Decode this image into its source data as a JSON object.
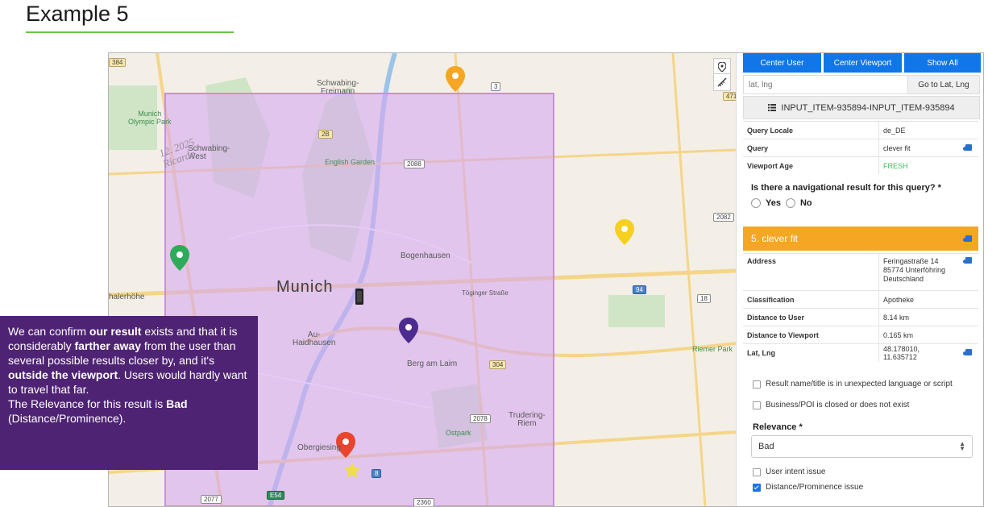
{
  "page": {
    "title": "Example 5",
    "accent_color": "#6cc24a"
  },
  "map": {
    "labels": {
      "schwabing_freimann": "Schwabing-\nFreimann",
      "munich_olympic_park": "Munich\nOlympic Park",
      "schwabing_west": "Schwabing-\nWest",
      "english_garden": "English Garden",
      "bogenhausen": "Bogenhausen",
      "munich": "Munich",
      "toginger_strasse": "Töginger Straße",
      "halerhohe": "halerhöhe",
      "au_haidhausen": "Au-\nHaidhausen",
      "berg_am_laim": "Berg am Laim",
      "riemer_park": "Riemer Park",
      "trudering_riem": "Trudering-\nRiem",
      "ostpark": "Ostpark",
      "obergiesing": "Obergiesing",
      "signature": "12. 2025\nRicardo"
    },
    "road_badges": [
      "384",
      "3",
      "471",
      "2B",
      "2088",
      "2082",
      "94",
      "18",
      "304",
      "2078",
      "8",
      "2077",
      "E54",
      "2360"
    ],
    "region_color": "#d6a9f0",
    "pin_colors": {
      "orange": "#f5a623",
      "yellow": "#f5d020",
      "green": "#2eab5a",
      "purple": "#4d2c91",
      "red": "#e8442e"
    }
  },
  "panel": {
    "buttons": {
      "center_user": "Center User",
      "center_viewport": "Center Viewport",
      "show_all": "Show All"
    },
    "latlng_placeholder": "lat, lng",
    "go_to_latlng": "Go to Lat, Lng",
    "input_item": "INPUT_ITEM-935894-INPUT_ITEM-935894",
    "query_rows": [
      {
        "key": "Query Locale",
        "value": "de_DE"
      },
      {
        "key": "Query",
        "value": "clever fit"
      },
      {
        "key": "Viewport Age",
        "value": "FRESH"
      }
    ],
    "fresh_color": "#3cbf5c",
    "navigational_question": "Is there a navigational result for this query? *",
    "yes": "Yes",
    "no": "No",
    "result_title": "5. clever fit",
    "result_color": "#f5a623",
    "result_rows": [
      {
        "key": "Address",
        "value": "Feringastraße 14\n85774 Unterföhring\nDeutschland"
      },
      {
        "key": "Classification",
        "value": "Apotheke"
      },
      {
        "key": "Distance to User",
        "value": "8.14 km"
      },
      {
        "key": "Distance to Viewport",
        "value": "0.165 km"
      },
      {
        "key": "Lat, Lng",
        "value": "48.178010, 11.635712"
      }
    ],
    "checks": [
      {
        "label": "Result name/title is in unexpected language or script",
        "checked": false
      },
      {
        "label": "Business/POI is closed or does not exist",
        "checked": false
      }
    ],
    "relevance_label": "Relevance *",
    "relevance_value": "Bad",
    "issues": [
      {
        "label": "User intent issue",
        "checked": false
      },
      {
        "label": "Distance/Prominence issue",
        "checked": true
      }
    ]
  },
  "annotation": {
    "p1": "We can confirm ",
    "p1b": "our result",
    "p2": " exists and that it is considerably ",
    "p2b": "farther away",
    "p3": " from the user than several possible results closer by, and it's ",
    "p3b": "outside the viewport",
    "p4": ". Users would hardly want to travel that far.",
    "p5": "The Relevance for this result is ",
    "p5b": "Bad",
    "p6": "(Distance/Prominence).",
    "background": "#4f2373"
  }
}
